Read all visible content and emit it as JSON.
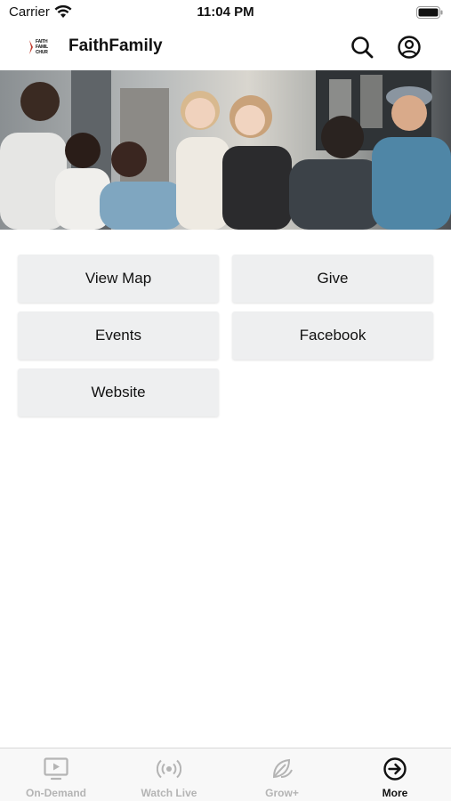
{
  "status_bar": {
    "carrier": "Carrier",
    "time": "11:04 PM"
  },
  "header": {
    "logo_lines": [
      "FAITH",
      "FAMIL",
      "CHUR"
    ],
    "app_title": "FaithFamily",
    "search_icon": "search-icon",
    "profile_icon": "user-circle-icon"
  },
  "banner": {
    "description_icon": "hero-photo"
  },
  "actions": [
    {
      "label": "View Map"
    },
    {
      "label": "Give"
    },
    {
      "label": "Events"
    },
    {
      "label": "Facebook"
    },
    {
      "label": "Website"
    }
  ],
  "tabs": [
    {
      "label": "On-Demand",
      "icon": "tv-play-icon",
      "active": false
    },
    {
      "label": "Watch Live",
      "icon": "broadcast-icon",
      "active": false
    },
    {
      "label": "Grow+",
      "icon": "leaf-icon",
      "active": false
    },
    {
      "label": "More",
      "icon": "arrow-circle-icon",
      "active": true
    }
  ],
  "colors": {
    "button_bg": "#eeeff0",
    "tab_inactive": "#b4b4b4",
    "tab_active": "#111111",
    "logo_accent": "#c0392b"
  }
}
